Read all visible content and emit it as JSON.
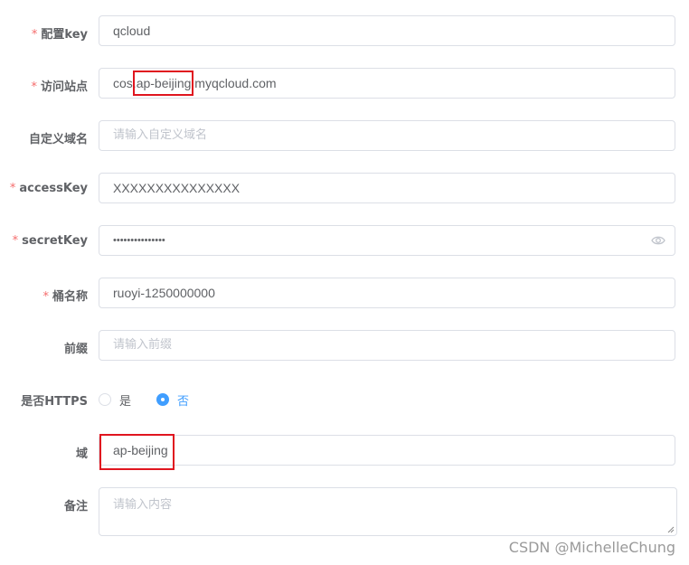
{
  "form": {
    "required_mark": "*",
    "fields": [
      {
        "label": "配置key",
        "required": true,
        "value": "qcloud",
        "placeholder": ""
      },
      {
        "label": "访问站点",
        "required": true,
        "value_parts": [
          "cos.",
          "ap-beijing",
          ".myqcloud.com"
        ]
      },
      {
        "label": "自定义域名",
        "required": false,
        "value": "",
        "placeholder": "请输入自定义域名"
      },
      {
        "label": "accessKey",
        "required": true,
        "value": "XXXXXXXXXXXXXXX"
      },
      {
        "label": "secretKey",
        "required": true,
        "value": "•••••••••••••••",
        "icon": "eye-icon"
      },
      {
        "label": "桶名称",
        "required": true,
        "value": "ruoyi-1250000000"
      },
      {
        "label": "前缀",
        "required": false,
        "value": "",
        "placeholder": "请输入前缀"
      },
      {
        "label": "是否HTTPS",
        "required": false,
        "options": [
          "是",
          "否"
        ],
        "selected": "否"
      },
      {
        "label": "域",
        "required": false,
        "value": "ap-beijing"
      },
      {
        "label": "备注",
        "required": false,
        "value": "",
        "placeholder": "请输入内容"
      }
    ]
  },
  "highlight_color": "#e0151f",
  "accent_color": "#409eff",
  "watermark": "CSDN @MichelleChung"
}
